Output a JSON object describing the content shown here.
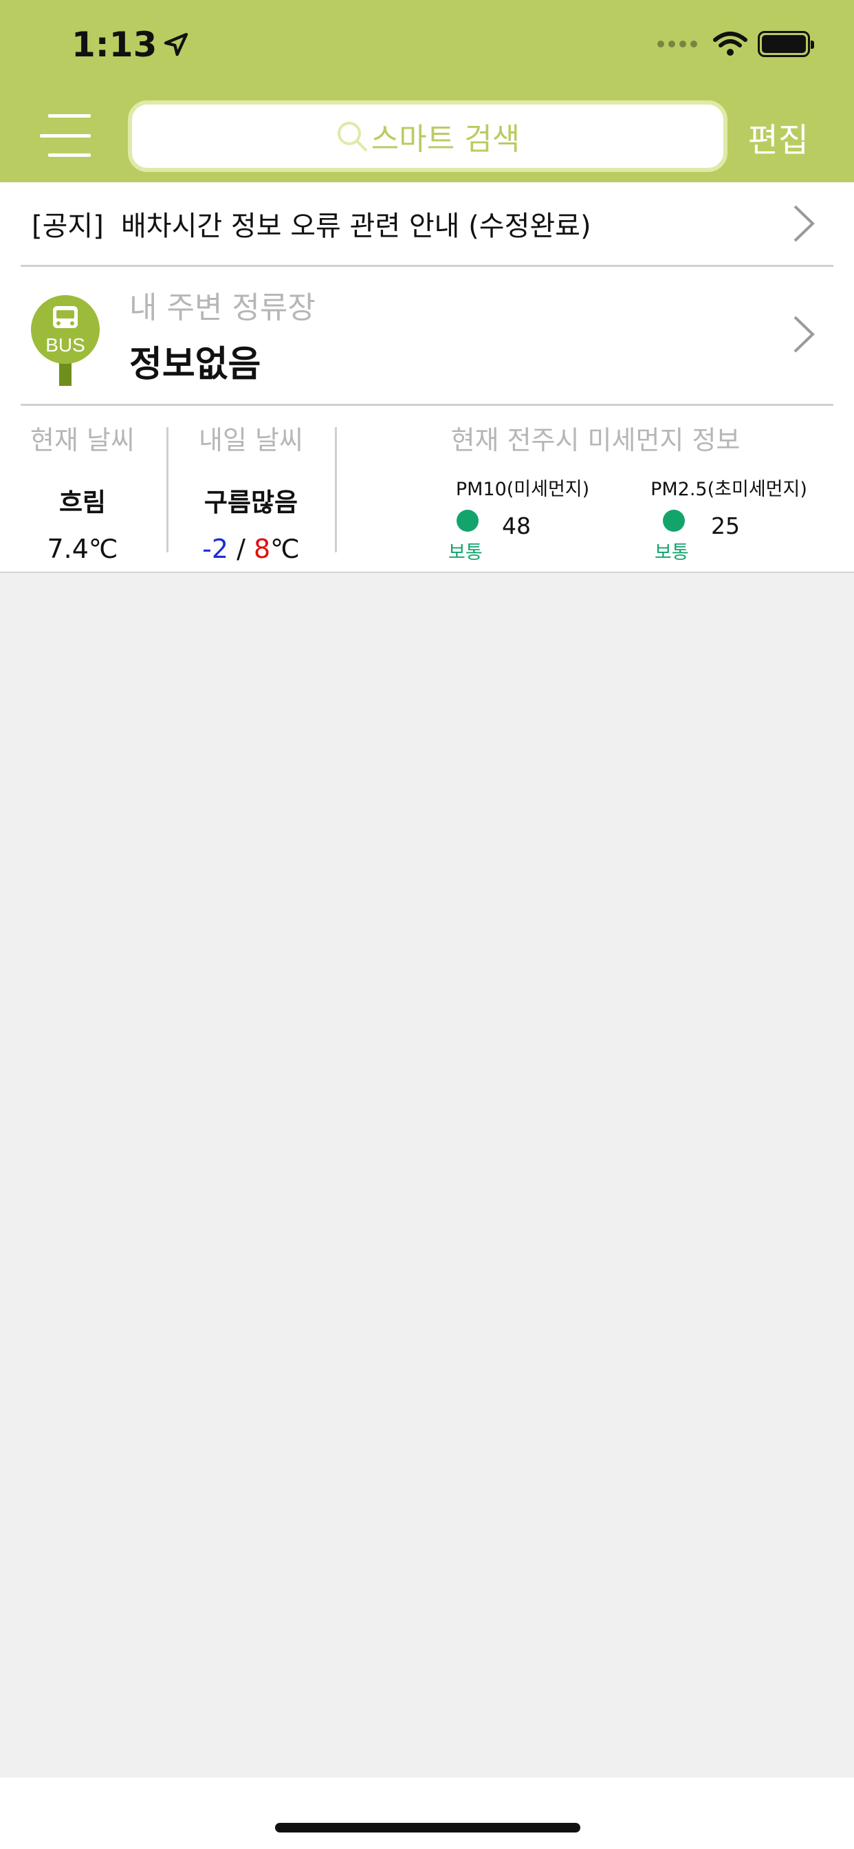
{
  "status_bar": {
    "time": "1:13"
  },
  "header": {
    "search_placeholder": "스마트 검색",
    "edit_label": "편집",
    "accent_color": "#b9cc62"
  },
  "notice": {
    "tag": "[공지]",
    "text": "배차시간 정보 오류 관련 안내 (수정완료)"
  },
  "nearby_stop": {
    "icon_label": "BUS",
    "label": "내 주변 정류장",
    "value": "정보없음"
  },
  "weather": {
    "today": {
      "title": "현재 날씨",
      "condition": "흐림",
      "temperature": "7.4℃"
    },
    "tomorrow": {
      "title": "내일 날씨",
      "condition": "구름많음",
      "low": "-2",
      "separator": " / ",
      "high": "8",
      "unit": "℃"
    }
  },
  "dust": {
    "title": "현재 전주시 미세먼지 정보",
    "pm10": {
      "label": "PM10(미세먼지)",
      "status": "보통",
      "value": "48"
    },
    "pm25": {
      "label": "PM2.5(초미세먼지)",
      "status": "보통",
      "value": "25"
    },
    "status_color": "#13a46c"
  }
}
